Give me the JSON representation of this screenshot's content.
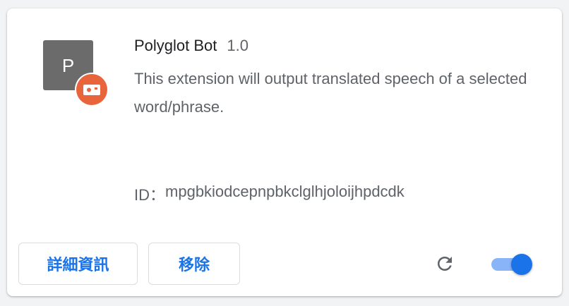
{
  "extension": {
    "icon_letter": "P",
    "icon_bg_color": "#6b6b6b",
    "badge_icon": "camera-badge-icon",
    "badge_color": "#e8653b",
    "name": "Polyglot Bot",
    "version": "1.0",
    "description": "This extension will output translated speech of a selected word/phrase.",
    "id_label": "ID：",
    "id_value": "mpgbkiodcepnpbkclglhjoloijhpdcdk",
    "enabled": true
  },
  "actions": {
    "details_label": "詳細資訊",
    "remove_label": "移除",
    "reload_icon": "reload-icon",
    "accent_color": "#1a73e8"
  }
}
